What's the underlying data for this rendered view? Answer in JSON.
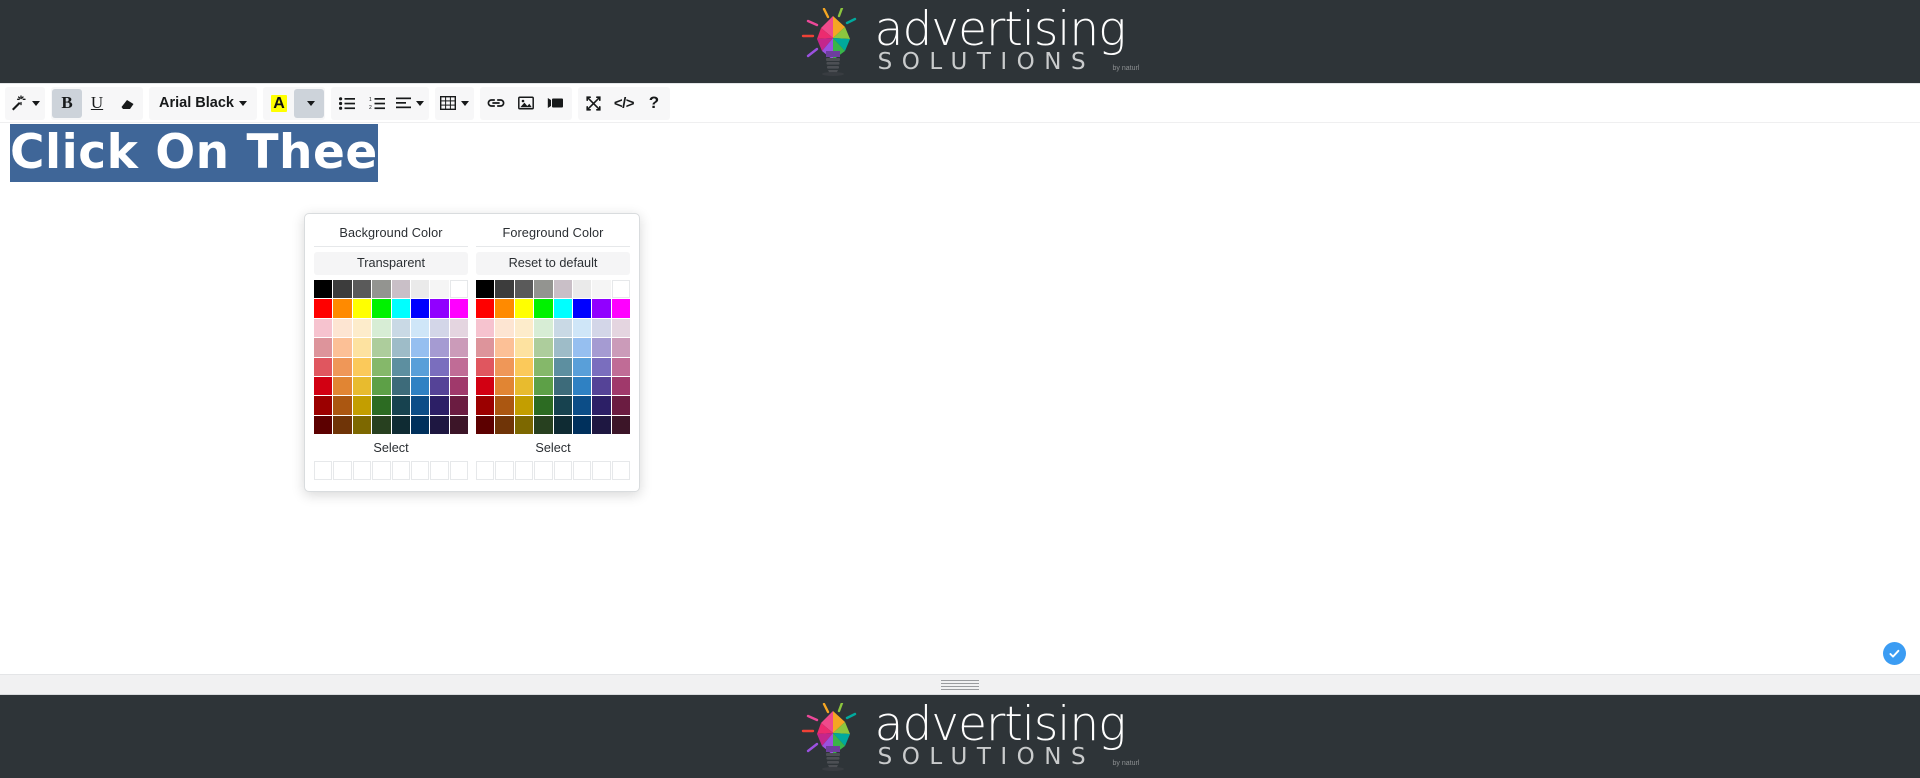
{
  "brand": {
    "name_main": "advertising",
    "name_sub": "SOLUTIONS",
    "trademark": "by naturl",
    "bar_color": "#2e3438"
  },
  "toolbar": {
    "groups": [
      {
        "name": "style-group",
        "buttons": [
          {
            "name": "magic-wand-icon",
            "label": "",
            "icon": "magic-wand",
            "caret": true,
            "active": false
          }
        ]
      },
      {
        "name": "format-group",
        "buttons": [
          {
            "name": "bold-button",
            "label": "B",
            "icon": "bold",
            "caret": false,
            "active": true
          },
          {
            "name": "underline-button",
            "label": "U",
            "icon": "underline",
            "caret": false,
            "active": false
          },
          {
            "name": "clear-formatting-button",
            "label": "",
            "icon": "eraser",
            "caret": false,
            "active": false
          }
        ]
      },
      {
        "name": "font-group",
        "buttons": [
          {
            "name": "font-family-select",
            "label": "Arial Black",
            "icon": "text",
            "caret": true,
            "active": false
          }
        ]
      },
      {
        "name": "color-group",
        "buttons": [
          {
            "name": "text-color-button",
            "label": "A",
            "icon": "highlighted-a",
            "caret": false,
            "active": false
          },
          {
            "name": "color-dropdown-toggle",
            "label": "",
            "icon": "none",
            "caret": true,
            "active": true
          }
        ]
      },
      {
        "name": "list-group",
        "buttons": [
          {
            "name": "unordered-list-button",
            "label": "",
            "icon": "bullet-list",
            "caret": false,
            "active": false
          },
          {
            "name": "ordered-list-button",
            "label": "",
            "icon": "numbered-list",
            "caret": false,
            "active": false
          },
          {
            "name": "align-button",
            "label": "",
            "icon": "align-left",
            "caret": true,
            "active": false
          }
        ]
      },
      {
        "name": "table-group",
        "buttons": [
          {
            "name": "insert-table-button",
            "label": "",
            "icon": "table",
            "caret": true,
            "active": false
          }
        ]
      },
      {
        "name": "insert-group",
        "buttons": [
          {
            "name": "insert-link-button",
            "label": "",
            "icon": "link",
            "caret": false,
            "active": false
          },
          {
            "name": "insert-image-button",
            "label": "",
            "icon": "image",
            "caret": false,
            "active": false
          },
          {
            "name": "insert-video-button",
            "label": "",
            "icon": "video",
            "caret": false,
            "active": false
          }
        ]
      },
      {
        "name": "tools-group",
        "buttons": [
          {
            "name": "fullscreen-button",
            "label": "",
            "icon": "fullscreen",
            "caret": false,
            "active": false
          },
          {
            "name": "code-view-button",
            "label": "</>",
            "icon": "code",
            "caret": false,
            "active": false
          },
          {
            "name": "help-button",
            "label": "?",
            "icon": "question",
            "caret": false,
            "active": false
          }
        ]
      }
    ]
  },
  "content": {
    "headline_visible": "Click On The",
    "headline_tail": "e",
    "selection_color": "#3f6698",
    "text_color": "#ffffff",
    "font_name": "Arial Black"
  },
  "color_popup": {
    "background": {
      "title": "Background Color",
      "action_label": "Transparent",
      "select_label": "Select",
      "rows": [
        [
          "#000000",
          "#3c3c3c",
          "#5a5a5a",
          "#939490",
          "#c9bfc7",
          "#eaeaea",
          "#f5f5f5",
          "#ffffff"
        ],
        [
          "#ff0000",
          "#ff8a00",
          "#ffff00",
          "#00f200",
          "#00ffff",
          "#0000ff",
          "#9100ff",
          "#ff00ff"
        ],
        [
          "#f6c3cf",
          "#fde5d2",
          "#fdeccb",
          "#d7edd5",
          "#c9d9e5",
          "#cfe6f8",
          "#d3d6e8",
          "#e4d5e0"
        ],
        [
          "#dd949b",
          "#fcc096",
          "#fde2a0",
          "#adcd9c",
          "#9ebcc8",
          "#96bff0",
          "#a59bd2",
          "#cb9bb9"
        ],
        [
          "#e0565f",
          "#ef9758",
          "#fbc95a",
          "#85b86a",
          "#5d8fa0",
          "#599fd9",
          "#7a6ebe",
          "#c06c96"
        ],
        [
          "#d20012",
          "#e18533",
          "#e8bb2e",
          "#5da047",
          "#3d6b7a",
          "#2f81c3",
          "#554397",
          "#a0396b"
        ],
        [
          "#9b0000",
          "#ab5711",
          "#c39e00",
          "#2c6b22",
          "#17424f",
          "#0c4d87",
          "#2c1f66",
          "#6b1c41"
        ],
        [
          "#5c0000",
          "#6f3407",
          "#7d6800",
          "#27401f",
          "#0f2b33",
          "#00305c",
          "#1e1741",
          "#3c1528"
        ]
      ]
    },
    "foreground": {
      "title": "Foreground Color",
      "action_label": "Reset to default",
      "select_label": "Select",
      "rows": [
        [
          "#000000",
          "#3c3c3c",
          "#5a5a5a",
          "#939490",
          "#c9bfc7",
          "#eaeaea",
          "#f5f5f5",
          "#ffffff"
        ],
        [
          "#ff0000",
          "#ff8a00",
          "#ffff00",
          "#00f200",
          "#00ffff",
          "#0000ff",
          "#9100ff",
          "#ff00ff"
        ],
        [
          "#f6c3cf",
          "#fde5d2",
          "#fdeccb",
          "#d7edd5",
          "#c9d9e5",
          "#cfe6f8",
          "#d3d6e8",
          "#e4d5e0"
        ],
        [
          "#dd949b",
          "#fcc096",
          "#fde2a0",
          "#adcd9c",
          "#9ebcc8",
          "#96bff0",
          "#a59bd2",
          "#cb9bb9"
        ],
        [
          "#e0565f",
          "#ef9758",
          "#fbc95a",
          "#85b86a",
          "#5d8fa0",
          "#599fd9",
          "#7a6ebe",
          "#c06c96"
        ],
        [
          "#d20012",
          "#e18533",
          "#e8bb2e",
          "#5da047",
          "#3d6b7a",
          "#2f81c3",
          "#554397",
          "#a0396b"
        ],
        [
          "#9b0000",
          "#ab5711",
          "#c39e00",
          "#2c6b22",
          "#17424f",
          "#0c4d87",
          "#2c1f66",
          "#6b1c41"
        ],
        [
          "#5c0000",
          "#6f3407",
          "#7d6800",
          "#27401f",
          "#0f2b33",
          "#00305c",
          "#1e1741",
          "#3c1528"
        ]
      ]
    },
    "recent_slots": 8
  },
  "footer_controls": {
    "confirm_icon": "check-icon",
    "confirm_color": "#3b9cf3",
    "resize_handle": "resize-grip"
  }
}
